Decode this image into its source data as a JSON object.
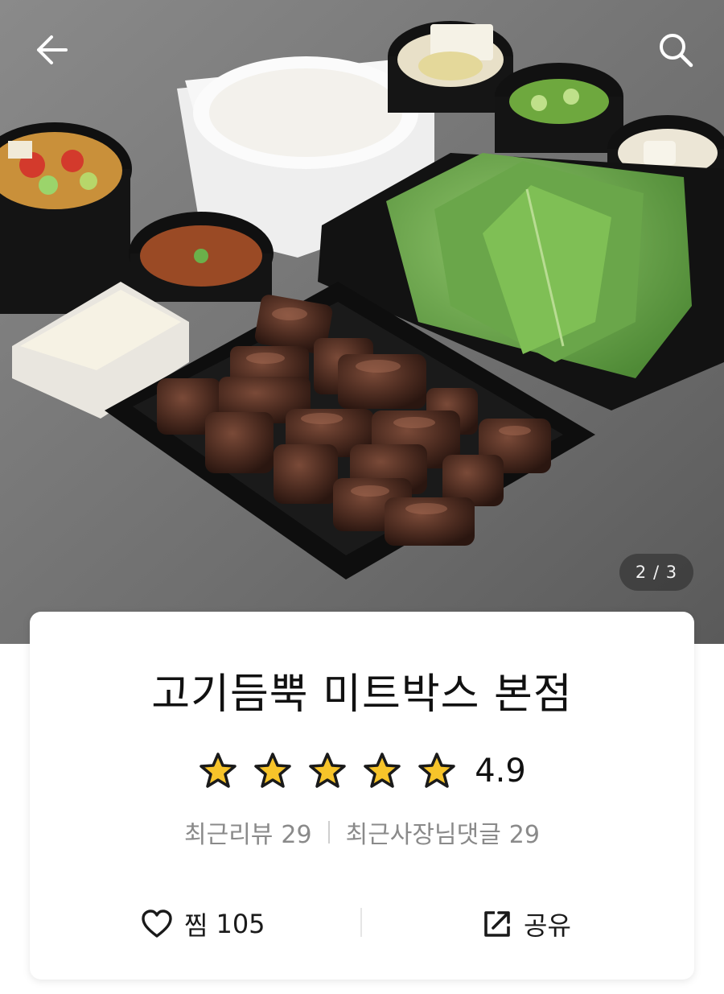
{
  "image": {
    "page_indicator": "2 / 3"
  },
  "store": {
    "name": "고기듬뿍 미트박스 본점",
    "rating": "4.9",
    "stars": 5,
    "recent_review_label": "최근리뷰",
    "recent_review_count": "29",
    "owner_reply_label": "최근사장님댓글",
    "owner_reply_count": "29"
  },
  "actions": {
    "like_label": "찜",
    "like_count": "105",
    "share_label": "공유"
  },
  "icons": {
    "back": "arrow-left-icon",
    "search": "search-icon",
    "like": "heart-outline-icon",
    "share": "share-icon",
    "star": "star-icon"
  },
  "colors": {
    "star_fill": "#F7C42A",
    "star_outline": "#1a1a1a",
    "title": "#111111",
    "meta_text": "#8a8a8a"
  }
}
